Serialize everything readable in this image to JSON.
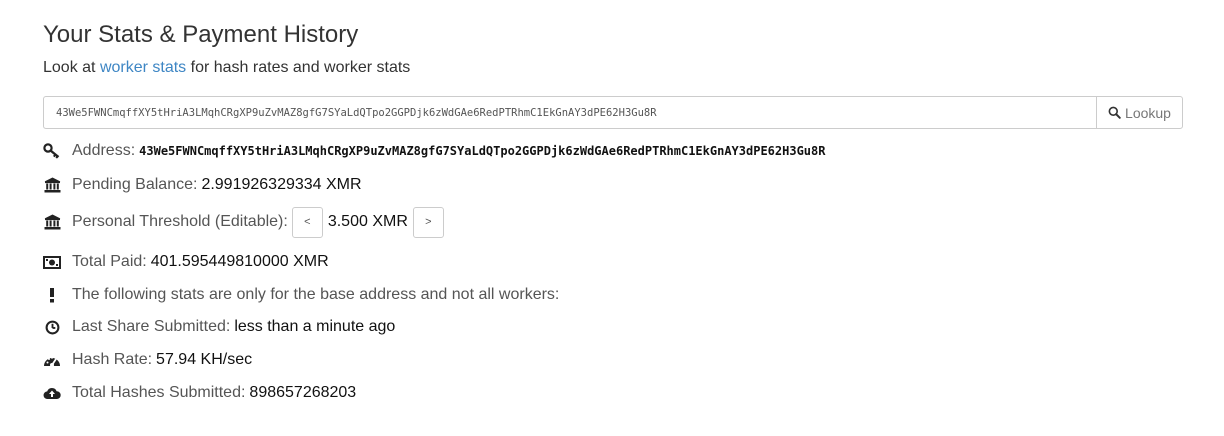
{
  "header": {
    "title": "Your Stats & Payment History",
    "subtitle_prefix": "Look at ",
    "subtitle_link": "worker stats",
    "subtitle_suffix": " for hash rates and worker stats"
  },
  "search": {
    "value": "43We5FWNCmqffXY5tHriA3LMqhCRgXP9uZvMAZ8gfG7SYaLdQTpo2GGPDjk6zWdGAe6RedPTRhmC1EkGnAY3dPE62H3Gu8R",
    "button_label": "Lookup"
  },
  "stats": {
    "address_label": "Address:",
    "address_value": "43We5FWNCmqffXY5tHriA3LMqhCRgXP9uZvMAZ8gfG7SYaLdQTpo2GGPDjk6zWdGAe6RedPTRhmC1EkGnAY3dPE62H3Gu8R",
    "pending_label": "Pending Balance:",
    "pending_value": "2.991926329334 XMR",
    "threshold_label": "Personal Threshold (Editable):",
    "threshold_dec": "<",
    "threshold_value": "3.500 XMR",
    "threshold_inc": ">",
    "paid_label": "Total Paid:",
    "paid_value": "401.595449810000 XMR",
    "notice": "The following stats are only for the base address and not all workers:",
    "last_share_label": "Last Share Submitted:",
    "last_share_value": "less than a minute ago",
    "hashrate_label": "Hash Rate:",
    "hashrate_value": "57.94 KH/sec",
    "hashes_label": "Total Hashes Submitted:",
    "hashes_value": "898657268203"
  },
  "icons": {
    "address": "key-icon",
    "pending": "bank-icon",
    "threshold": "bank-icon",
    "paid": "money-icon",
    "notice": "exclamation-icon",
    "last_share": "clock-icon",
    "hashrate": "dashboard-icon",
    "hashes": "cloud-upload-icon",
    "search": "search-icon"
  },
  "colors": {
    "link": "#3e86c4",
    "text": "#333333",
    "label": "#555555"
  }
}
